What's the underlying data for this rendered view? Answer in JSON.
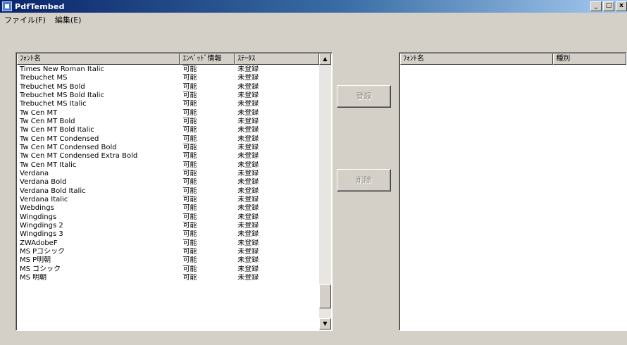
{
  "window": {
    "title": "PdfTembed",
    "buttons": {
      "minimize": "_",
      "maximize": "□",
      "close": "x"
    }
  },
  "menu": [
    {
      "label": "ファイル(F)"
    },
    {
      "label": "編集(E)"
    }
  ],
  "left_list": {
    "columns": [
      "ﾌｫﾝﾄ名",
      "ｴﾝﾍﾞｯﾄﾞ情報",
      "ｽﾃｰﾀｽ"
    ],
    "rows": [
      [
        "Times New Roman Italic",
        "可能",
        "未登録"
      ],
      [
        "Trebuchet MS",
        "可能",
        "未登録"
      ],
      [
        "Trebuchet MS Bold",
        "可能",
        "未登録"
      ],
      [
        "Trebuchet MS Bold Italic",
        "可能",
        "未登録"
      ],
      [
        "Trebuchet MS Italic",
        "可能",
        "未登録"
      ],
      [
        "Tw Cen MT",
        "可能",
        "未登録"
      ],
      [
        "Tw Cen MT Bold",
        "可能",
        "未登録"
      ],
      [
        "Tw Cen MT Bold Italic",
        "可能",
        "未登録"
      ],
      [
        "Tw Cen MT Condensed",
        "可能",
        "未登録"
      ],
      [
        "Tw Cen MT Condensed Bold",
        "可能",
        "未登録"
      ],
      [
        "Tw Cen MT Condensed Extra Bold",
        "可能",
        "未登録"
      ],
      [
        "Tw Cen MT Italic",
        "可能",
        "未登録"
      ],
      [
        "Verdana",
        "可能",
        "未登録"
      ],
      [
        "Verdana Bold",
        "可能",
        "未登録"
      ],
      [
        "Verdana Bold Italic",
        "可能",
        "未登録"
      ],
      [
        "Verdana Italic",
        "可能",
        "未登録"
      ],
      [
        "Webdings",
        "可能",
        "未登録"
      ],
      [
        "Wingdings",
        "可能",
        "未登録"
      ],
      [
        "Wingdings 2",
        "可能",
        "未登録"
      ],
      [
        "Wingdings 3",
        "可能",
        "未登録"
      ],
      [
        "ZWAdobeF",
        "可能",
        "未登録"
      ],
      [
        "MS Pゴシック",
        "可能",
        "未登録"
      ],
      [
        "MS P明朝",
        "可能",
        "未登録"
      ],
      [
        "MS ゴシック",
        "可能",
        "未登録"
      ],
      [
        "MS 明朝",
        "可能",
        "未登録"
      ]
    ],
    "scroll_position": 0.95
  },
  "buttons": {
    "register": "登録",
    "delete": "削除"
  },
  "right_list": {
    "columns": [
      "ﾌｫﾝﾄ名",
      "種別"
    ],
    "rows": []
  },
  "colors": {
    "title_start": "#0a246a",
    "title_end": "#a6caf0",
    "face": "#d4d0c8",
    "disabled_text": "#8f8c86"
  }
}
